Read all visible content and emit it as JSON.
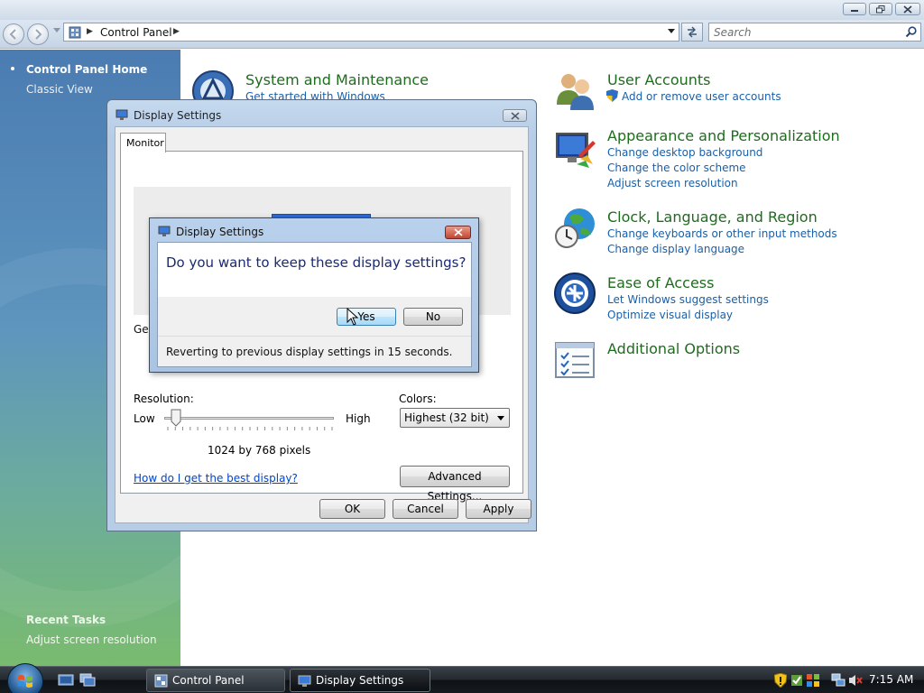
{
  "address": {
    "location": "Control Panel"
  },
  "search": {
    "placeholder": "Search"
  },
  "sidebar": {
    "home": "Control Panel Home",
    "classic": "Classic View",
    "recent_title": "Recent Tasks",
    "recent_item": "Adjust screen resolution"
  },
  "categories": {
    "system": {
      "title": "System and Maintenance",
      "links": [
        "Get started with Windows"
      ]
    },
    "users": {
      "title": "User Accounts",
      "links": [
        "Add or remove user accounts"
      ]
    },
    "appearance": {
      "title": "Appearance and Personalization",
      "links": [
        "Change desktop background",
        "Change the color scheme",
        "Adjust screen resolution"
      ]
    },
    "clock": {
      "title": "Clock, Language, and Region",
      "links": [
        "Change keyboards or other input methods",
        "Change display language"
      ]
    },
    "ease": {
      "title": "Ease of Access",
      "links": [
        "Let Windows suggest settings",
        "Optimize visual display"
      ]
    },
    "additional": {
      "title": "Additional Options"
    }
  },
  "display_dialog": {
    "title": "Display Settings",
    "tab": "Monitor",
    "partial_label": "Ger",
    "resolution_label": "Resolution:",
    "low": "Low",
    "high": "High",
    "resolution_value": "1024 by 768 pixels",
    "slider_level": 0,
    "colors_label": "Colors:",
    "colors_value": "Highest (32 bit)",
    "help_link": "How do I get the best display?",
    "advanced": "Advanced Settings...",
    "ok": "OK",
    "cancel": "Cancel",
    "apply": "Apply"
  },
  "confirm_dialog": {
    "title": "Display Settings",
    "question": "Do you want to keep these display settings?",
    "yes": "Yes",
    "no": "No",
    "countdown": "Reverting to previous display settings in 15 seconds."
  },
  "taskbar": {
    "tasks": [
      "Control Panel",
      "Display Settings"
    ],
    "clock": "7:15 AM"
  },
  "colors": {
    "category_title": "#1e6c1e",
    "link": "#1a5fa8",
    "close_red": "#c2452f"
  }
}
